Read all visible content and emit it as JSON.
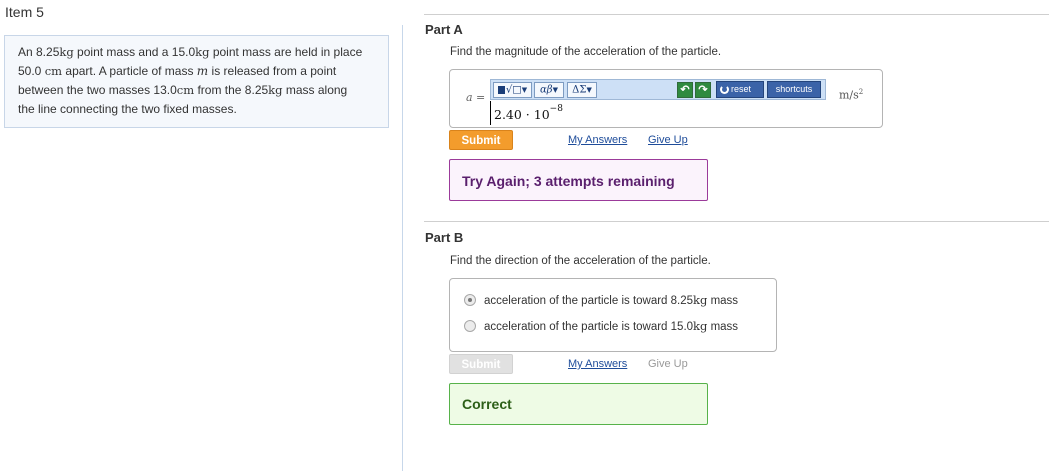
{
  "item": {
    "title": "Item 5"
  },
  "problem": {
    "line1_a": "An 8.25",
    "line1_b": "kg",
    "line1_c": " point mass and a 15.0",
    "line1_d": "kg",
    "line1_e": " point mass are held in place",
    "line2_a": "50.0 ",
    "line2_b": "cm",
    "line2_c": " apart. A particle of mass ",
    "line2_d": "m",
    "line2_e": " is released from a point",
    "line3_a": "between the two masses 13.0",
    "line3_b": "cm",
    "line3_c": " from the 8.25",
    "line3_d": "kg",
    "line3_e": " mass along",
    "line4": "the line connecting the two fixed masses."
  },
  "partA": {
    "label": "Part A",
    "question": "Find the magnitude of the acceleration of the particle.",
    "variable": "a",
    "equals": " =",
    "toolbar": {
      "templates_label": "√□",
      "greek_label": "αβ",
      "delta_label": "ΔΣ",
      "undo_icon": "undo-icon",
      "redo_icon": "redo-icon",
      "reset_label": "reset",
      "shortcuts_label": "shortcuts"
    },
    "answer_base": "2.40 · 10",
    "answer_exponent": "−8",
    "unit_base": "m/s",
    "unit_exp": "2",
    "submit_label": "Submit",
    "my_answers_label": "My Answers",
    "give_up_label": "Give Up",
    "feedback": "Try Again; 3 attempts remaining"
  },
  "partB": {
    "label": "Part B",
    "question": "Find the direction of the acceleration of the particle.",
    "options": [
      {
        "text_a": "acceleration of the particle is toward 8.25",
        "text_b": "kg",
        "text_c": " mass",
        "selected": true
      },
      {
        "text_a": "acceleration of the particle is toward 15.0",
        "text_b": "kg",
        "text_c": " mass",
        "selected": false
      }
    ],
    "submit_label": "Submit",
    "my_answers_label": "My Answers",
    "give_up_label": "Give Up",
    "feedback": "Correct"
  },
  "colors": {
    "accent_submit": "#f39c2c",
    "link": "#1e4c9a",
    "try_again_border": "#9b3a9a",
    "correct_border": "#57b24a"
  }
}
